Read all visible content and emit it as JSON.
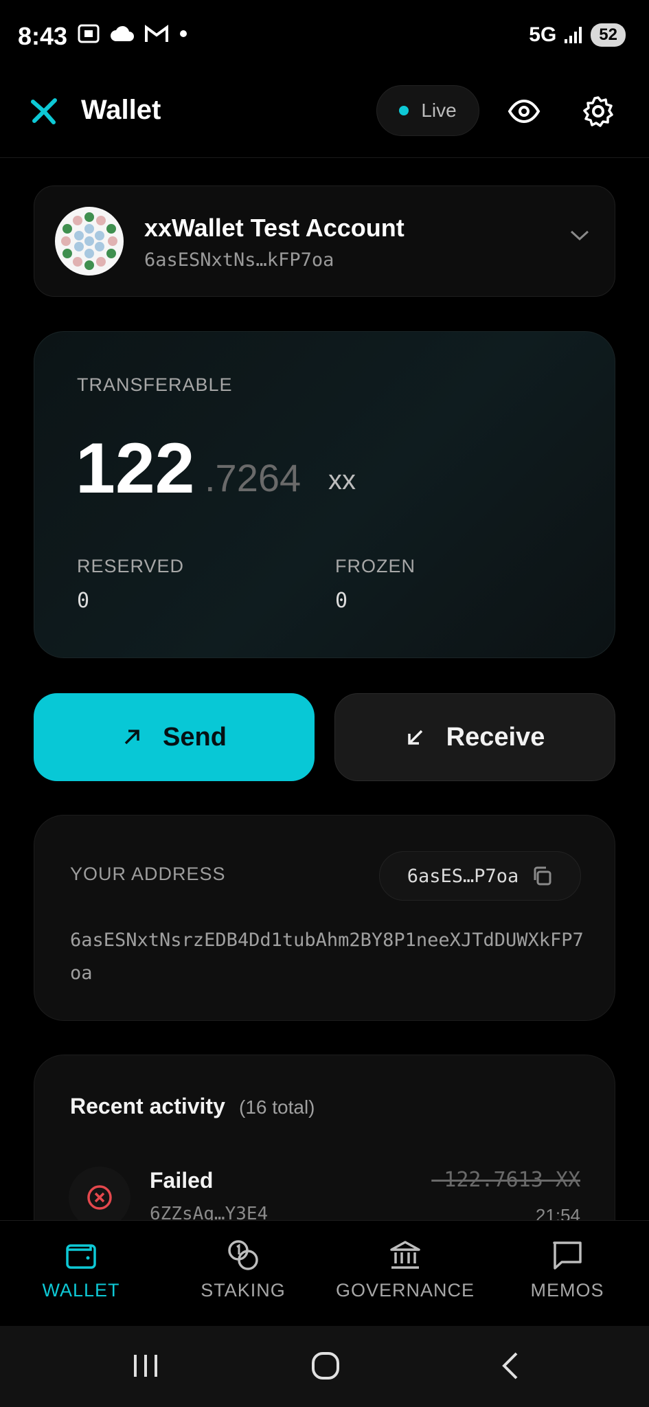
{
  "status_bar": {
    "time": "8:43",
    "network": "5G",
    "battery": "52"
  },
  "header": {
    "title": "Wallet",
    "live_label": "Live",
    "icons": [
      "logo-icon",
      "eye-icon",
      "gear-icon"
    ]
  },
  "account": {
    "name": "xxWallet Test Account",
    "address_short": "6asESNxtNs…kFP7oa"
  },
  "balance": {
    "label": "TRANSFERABLE",
    "integer": "122",
    "decimal": ".7264",
    "unit": "xx",
    "reserved_label": "RESERVED",
    "reserved_value": "0",
    "frozen_label": "FROZEN",
    "frozen_value": "0"
  },
  "actions": {
    "send_label": "Send",
    "receive_label": "Receive"
  },
  "address": {
    "label": "YOUR ADDRESS",
    "chip": "6asES…P7oa",
    "full": "6asESNxtNsrzEDB4Dd1tubAhm2BY8P1neeXJTdDUWXkFP7oa"
  },
  "activity": {
    "title": "Recent activity",
    "count": "(16 total)",
    "items": [
      {
        "status": "Failed",
        "hash": "6ZZsAq…Y3E4",
        "amount": "-122.7613 XX",
        "time": "21:54"
      }
    ]
  },
  "nav": {
    "items": [
      {
        "label": "WALLET",
        "icon": "wallet-icon",
        "active": true
      },
      {
        "label": "STAKING",
        "icon": "coins-icon",
        "active": false
      },
      {
        "label": "GOVERNANCE",
        "icon": "bank-icon",
        "active": false
      },
      {
        "label": "MEMOS",
        "icon": "chat-icon",
        "active": false
      }
    ]
  },
  "colors": {
    "accent": "#08c8d6",
    "background": "#000000",
    "error": "#e5484d"
  }
}
